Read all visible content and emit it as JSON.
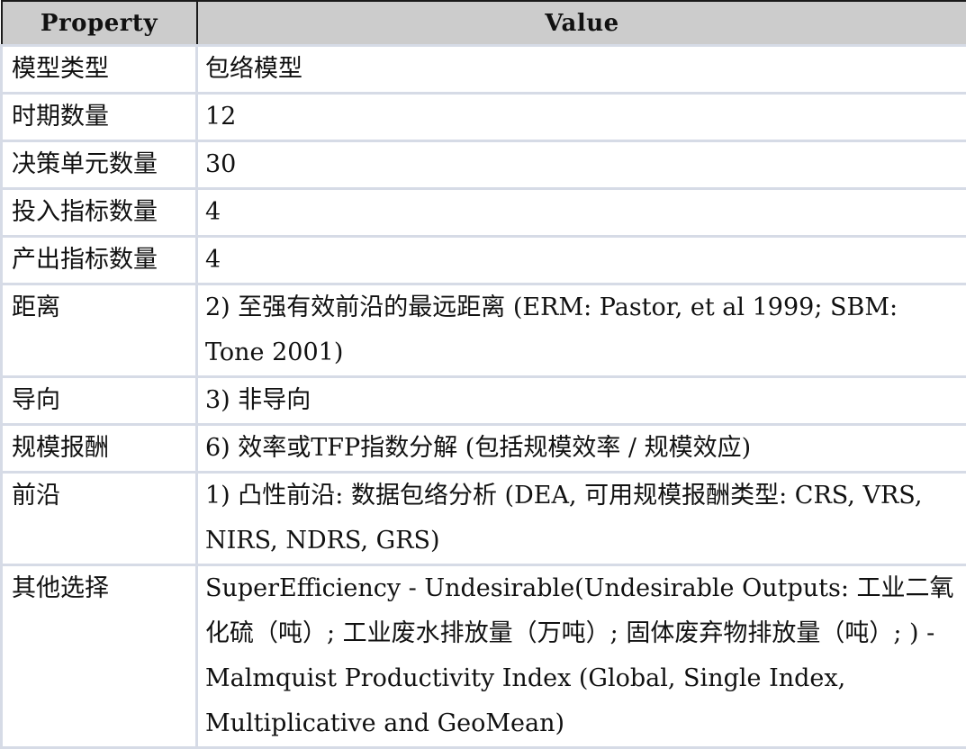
{
  "table": {
    "headers": [
      "Property",
      "Value"
    ],
    "rows": [
      {
        "property": "模型类型",
        "value": "包络模型"
      },
      {
        "property": "时期数量",
        "value": "12"
      },
      {
        "property": "决策单元数量",
        "value": "30"
      },
      {
        "property": "投入指标数量",
        "value": "4"
      },
      {
        "property": "产出指标数量",
        "value": "4"
      },
      {
        "property": "距离",
        "value": "2) 至强有效前沿的最远距离 (ERM: Pastor, et al 1999; SBM: Tone 2001)"
      },
      {
        "property": "导向",
        "value": "3) 非导向"
      },
      {
        "property": "规模报酬",
        "value": "6) 效率或TFP指数分解 (包括规模效率 / 规模效应)"
      },
      {
        "property": "前沿",
        "value": "1) 凸性前沿: 数据包络分析 (DEA, 可用规模报酬类型: CRS, VRS, NIRS, NDRS, GRS)"
      },
      {
        "property": "其他选择",
        "value": "SuperEfficiency - Undesirable(Undesirable Outputs: 工业二氧化硫（吨）; 工业废水排放量（万吨）; 固体废弃物排放量（吨）; ) - Malmquist Productivity Index (Global, Single Index, Multiplicative and GeoMean)"
      }
    ]
  }
}
